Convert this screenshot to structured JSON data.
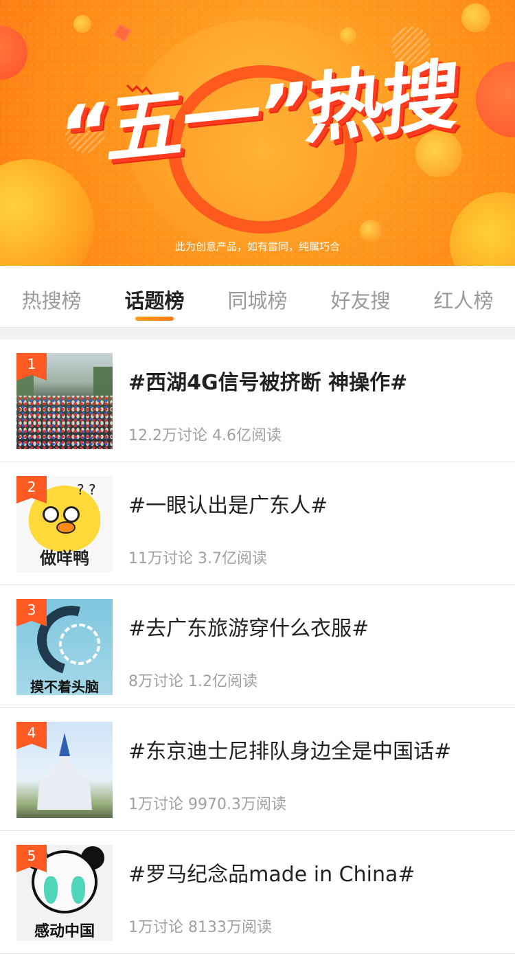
{
  "banner": {
    "title": "“五一”热搜",
    "note": "此为创意产品，如有雷同，纯属巧合"
  },
  "tabs": [
    {
      "label": "热搜榜",
      "active": false
    },
    {
      "label": "话题榜",
      "active": true
    },
    {
      "label": "同城榜",
      "active": false
    },
    {
      "label": "好友搜",
      "active": false
    },
    {
      "label": "红人榜",
      "active": false
    }
  ],
  "colors": {
    "accent": "#ff8a14",
    "rank_badge": "#ff5a24",
    "stats_text": "#a0a0a0"
  },
  "topics": [
    {
      "rank": "1",
      "title": "#西湖4G信号被挤断 神操作#",
      "stats": "12.2万讨论 4.6亿阅读",
      "thumb_caption": ""
    },
    {
      "rank": "2",
      "title": "#一眼认出是广东人#",
      "stats": "11万讨论 3.7亿阅读",
      "thumb_caption": "做咩鸭"
    },
    {
      "rank": "3",
      "title": "#去广东旅游穿什么衣服#",
      "stats": "8万讨论 1.2亿阅读",
      "thumb_caption": "摸不着头脑"
    },
    {
      "rank": "4",
      "title": "#东京迪士尼排队身边全是中国话#",
      "stats": "1万讨论 9970.3万阅读",
      "thumb_caption": ""
    },
    {
      "rank": "5",
      "title": "#罗马纪念品made in China#",
      "stats": "1万讨论 8133万阅读",
      "thumb_caption": "感动中国"
    }
  ]
}
